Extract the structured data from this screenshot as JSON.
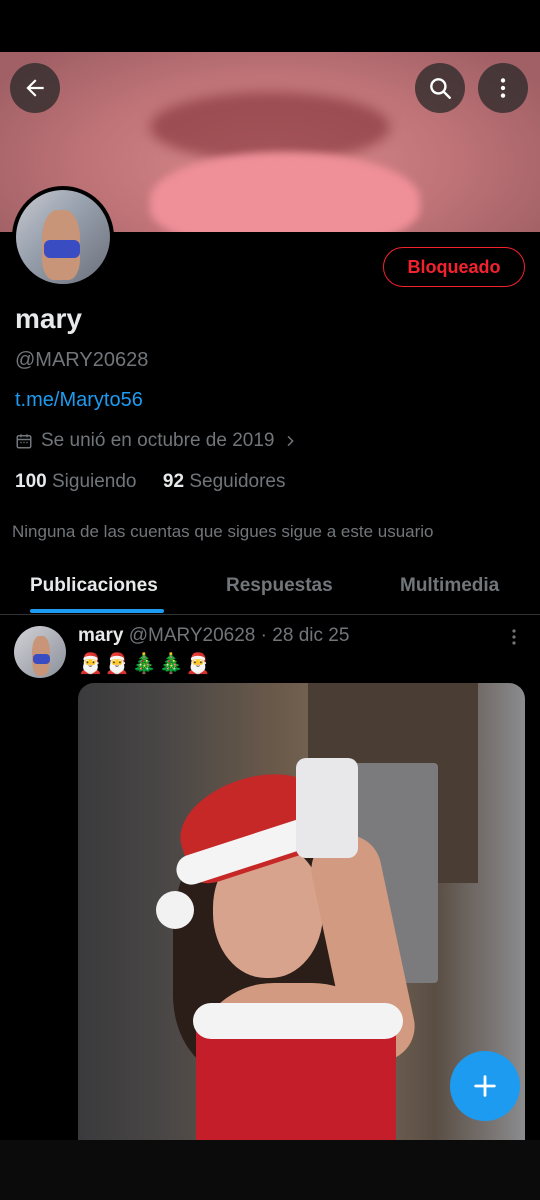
{
  "banner": {
    "back_icon": "arrow-left-icon",
    "search_icon": "search-icon",
    "more_icon": "more-vertical-icon"
  },
  "profile": {
    "status_button": "Bloqueado",
    "name": "mary",
    "handle": "@MARY20628",
    "link": "t.me/Maryto56",
    "joined": "Se unió en octubre de 2019",
    "following_count": "100",
    "following_label": "Siguiendo",
    "followers_count": "92",
    "followers_label": "Seguidores",
    "notice": "Ninguna de las cuentas que sigues sigue a este usuario"
  },
  "tabs": [
    "Publicaciones",
    "Respuestas",
    "Multimedia"
  ],
  "post": {
    "name": "mary",
    "handle": "@MARY20628",
    "separator": "·",
    "date": "28 dic 25",
    "text": "🎅🎅🎄🎄🎅"
  },
  "colors": {
    "accent": "#1d9bf0",
    "danger": "#f4212e",
    "background": "#000000"
  }
}
